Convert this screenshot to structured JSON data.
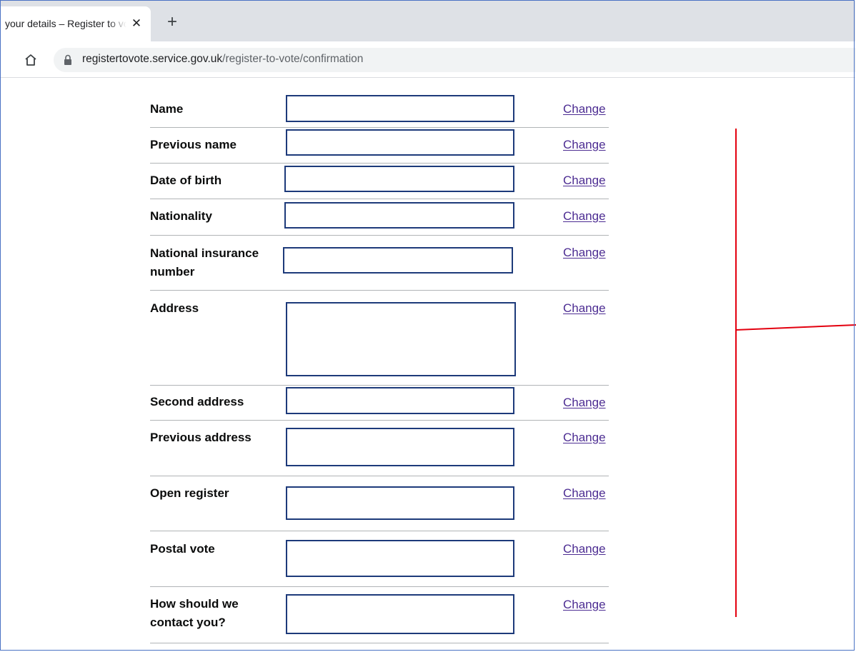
{
  "browser": {
    "tab_title": "your details – Register to vote",
    "tab_close": "✕",
    "new_tab": "+",
    "url_host": "registertovote.service.gov.uk",
    "url_path": "/register-to-vote/confirmation"
  },
  "rows": [
    {
      "label": "Name",
      "change": "Change"
    },
    {
      "label": "Previous name",
      "change": "Change"
    },
    {
      "label": "Date of birth",
      "change": "Change"
    },
    {
      "label": "Nationality",
      "change": "Change"
    },
    {
      "label": "National insurance number",
      "change": "Change"
    },
    {
      "label": "Address",
      "change": "Change"
    },
    {
      "label": "Second address",
      "change": "Change"
    },
    {
      "label": "Previous address",
      "change": "Change"
    },
    {
      "label": "Open register",
      "change": "Change"
    },
    {
      "label": "Postal vote",
      "change": "Change"
    },
    {
      "label": "How should we contact you?",
      "change": "Change"
    }
  ],
  "colors": {
    "link": "#4c2c92",
    "field_border": "#1d3a7a",
    "annotation": "#e3000f"
  }
}
